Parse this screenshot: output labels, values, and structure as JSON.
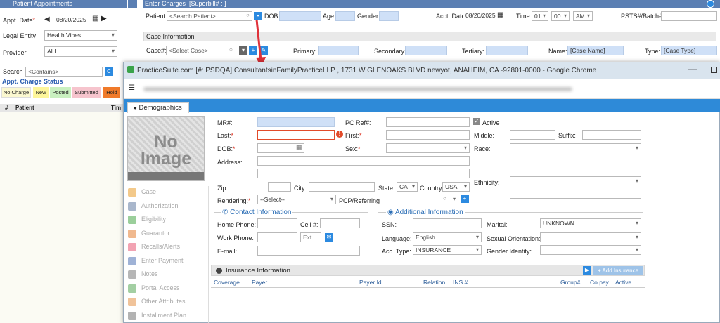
{
  "left_panel": {
    "title": "Patient Appointments",
    "appt_date_label": "Appt. Date",
    "appt_date": "08/20/2025",
    "legal_entity_label": "Legal Entity",
    "legal_entity": "Health Vibes",
    "provider_label": "Provider",
    "provider": "ALL",
    "search_label": "Search",
    "search_placeholder": "<Contains>",
    "search_btn": "C",
    "status_title": "Appt. Charge Status",
    "statuses": [
      "No Charge",
      "New",
      "Posted",
      "Submitted",
      "Hold"
    ],
    "col_num": "#",
    "col_patient": "Patient",
    "col_time": "Tim"
  },
  "top_form": {
    "title": "Enter Charges",
    "superbill": "[Superbill# : ]",
    "patient_label": "Patient:",
    "patient_placeholder": "<Search Patient>",
    "dob_label": "DOB",
    "age_label": "Age",
    "gender_label": "Gender",
    "acct_date_label": "Acct. Date",
    "acct_date": "08/20/2025",
    "time_label": "Time",
    "hour": "01",
    "minute": "00",
    "ampm": "AM",
    "psts_label": "PSTS#/Batch#:",
    "case_info_title": "Case Information",
    "case_label": "Case#:",
    "case_placeholder": "<Select Case>",
    "primary_label": "Primary:",
    "secondary_label": "Secondary:",
    "tertiary_label": "Tertiary:",
    "name_label": "Name:",
    "name_value": "[Case Name]",
    "type_label": "Type:",
    "type_value": "[Case Type]"
  },
  "popup": {
    "window_title": "PracticeSuite.com [#: PSDQA] ConsultantsinFamilyPracticeLLP , 1731 W GLENOAKS BLVD newyot, ANAHEIM, CA -92801-0000 - Google Chrome",
    "tab": "Demographics",
    "no_image": "No Image",
    "nav": [
      "Case",
      "Authorization",
      "Eligibility",
      "Guarantor",
      "Recalls/Alerts",
      "Enter Payment",
      "Notes",
      "Portal Access",
      "Other Attributes",
      "Installment Plan"
    ],
    "nav_colors": [
      "#f3c98a",
      "#a9b7cc",
      "#9bcf9b",
      "#f0b98f",
      "#f2a3b3",
      "#9fb2d6",
      "#b6b6b6",
      "#a3cfa3",
      "#f0c39a",
      "#b3b3b3"
    ],
    "mr_label": "MR#:",
    "pcref_label": "PC Ref#:",
    "active_label": "Active",
    "last_label": "Last:",
    "first_label": "First:",
    "middle_label": "Middle:",
    "suffix_label": "Suffix:",
    "dob_label": "DOB:",
    "sex_label": "Sex:",
    "race_label": "Race:",
    "address_label": "Address:",
    "ethnicity_label": "Ethnicity:",
    "zip_label": "Zip:",
    "city_label": "City:",
    "state_label": "State:",
    "state_value": "CA",
    "country_label": "Country:",
    "country_value": "USA",
    "rendering_label": "Rendering:",
    "rendering_value": "--Select--",
    "pcp_label": "PCP/Referring:",
    "contact_title": "Contact Information",
    "home_phone_label": "Home Phone:",
    "cell_label": "Cell #:",
    "work_phone_label": "Work Phone:",
    "ext_placeholder": "Ext",
    "email_label": "E-mail:",
    "additional_title": "Additional Information",
    "ssn_label": "SSN:",
    "marital_label": "Marital:",
    "marital_value": "UNKNOWN",
    "language_label": "Language:",
    "language_value": "English",
    "sexual_orientation_label": "Sexual Orientation:",
    "acc_type_label": "Acc. Type:",
    "acc_type_value": "INSURANCE",
    "gender_identity_label": "Gender Identity:",
    "insurance_title": "Insurance Information",
    "add_insurance": "+ Add Insurance",
    "ins_columns": [
      "Coverage",
      "Payer",
      "Payer Id",
      "Relation",
      "INS.#",
      "Group#",
      "Co pay",
      "Active"
    ]
  }
}
